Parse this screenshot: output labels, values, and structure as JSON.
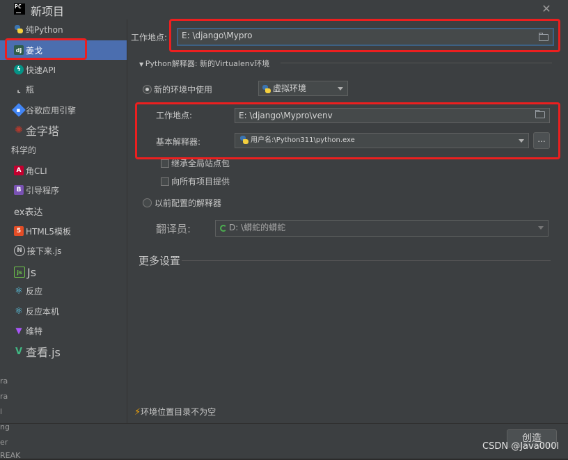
{
  "window": {
    "title": "新项目",
    "close": "✕",
    "logo": "PC"
  },
  "sidebar": {
    "items": [
      {
        "label": "纯Python",
        "icon": "python-icon"
      },
      {
        "label": "姜戈",
        "icon": "django-icon"
      },
      {
        "label": "快速API",
        "icon": "fastapi-icon"
      },
      {
        "label": "瓶",
        "icon": "flask-icon"
      },
      {
        "label": "谷歌应用引擎",
        "icon": "google-app-engine-icon"
      },
      {
        "label": "金字塔",
        "icon": "pyramid-icon"
      },
      {
        "label": "科学的",
        "icon": ""
      },
      {
        "label": "角CLI",
        "icon": "angular-icon"
      },
      {
        "label": "引导程序",
        "icon": "bootstrap-icon"
      },
      {
        "label": "ex表达",
        "icon": "express-icon"
      },
      {
        "label": "HTML5模板",
        "icon": "html5-icon"
      },
      {
        "label": "接下来.js",
        "icon": "nextjs-icon"
      },
      {
        "label": "Js",
        "icon": "nodejs-icon"
      },
      {
        "label": "反应",
        "icon": "react-icon"
      },
      {
        "label": "反应本机",
        "icon": "react-native-icon"
      },
      {
        "label": "维特",
        "icon": "vite-icon"
      },
      {
        "label": "查看.js",
        "icon": "vue-icon"
      }
    ]
  },
  "main": {
    "location_label": "工作地点:",
    "location_value": "E: \\django\\Mypro",
    "interpreter_section": "Python解释器: 新的Virtualenv环境",
    "new_env_label": "新的环境中使用",
    "env_type": "虚拟环境",
    "venv_location_label": "工作地点:",
    "venv_location_value": "E: \\django\\Mypro\\venv",
    "base_interp_label": "基本解释器:",
    "base_interp_value": "用户名:\\Python311\\python.exe",
    "dots": "...",
    "inherit_label": "继承全局站点包",
    "available_label": "向所有项目提供",
    "prev_interp_label": "以前配置的解释器",
    "interpreter_label": "翻译员:",
    "interpreter_value": "D: \\蟒蛇的蟒蛇",
    "more_settings": "更多设置",
    "warning": "环境位置目录不为空"
  },
  "footer": {
    "create": "创造",
    "watermark": "CSDN @Java000l"
  },
  "edge_text": [
    "ra",
    "ra",
    "l",
    "ng",
    "er",
    "REAK"
  ]
}
